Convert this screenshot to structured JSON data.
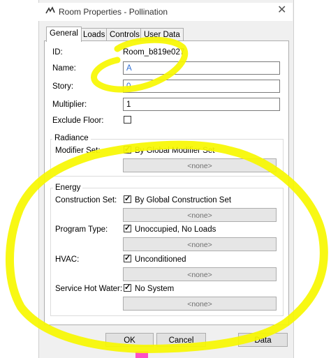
{
  "window": {
    "title": "Room Properties - Pollination"
  },
  "tabs": [
    "General",
    "Loads",
    "Controls",
    "User Data"
  ],
  "general": {
    "id_label": "ID:",
    "id_value": "Room_b819e027",
    "name_label": "Name:",
    "name_value": "A",
    "story_label": "Story:",
    "story_value": "0",
    "multiplier_label": "Multiplier:",
    "multiplier_value": "1",
    "exclude_floor_label": "Exclude Floor:"
  },
  "radiance": {
    "group_title": "Radiance",
    "modifier_set_label": "Modifier Set:",
    "modifier_set_checkbox": "By Global Modifier Set",
    "modifier_set_value": "<none>"
  },
  "energy": {
    "group_title": "Energy",
    "construction_set_label": "Construction Set:",
    "construction_set_checkbox": "By Global Construction Set",
    "construction_set_value": "<none>",
    "program_type_label": "Program Type:",
    "program_type_checkbox": "Unoccupied, No Loads",
    "program_type_value": "<none>",
    "hvac_label": "HVAC:",
    "hvac_checkbox": "Unconditioned",
    "hvac_value": "<none>",
    "shw_label": "Service Hot Water:",
    "shw_checkbox": "No System",
    "shw_value": "<none>"
  },
  "buttons": {
    "ok": "OK",
    "cancel": "Cancel",
    "data": "Data"
  },
  "colors": {
    "highlight": "#f7f700",
    "link_blue": "#2f6fd6"
  }
}
